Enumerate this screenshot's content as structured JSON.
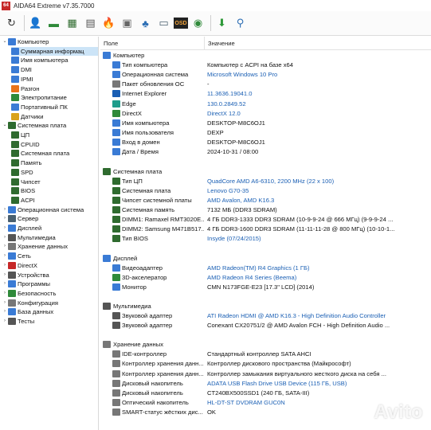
{
  "title": {
    "app_icon_text": "64",
    "text": "AIDA64 Extreme v7.35.7000"
  },
  "toolbar": {
    "buttons": [
      {
        "icon": "refresh-icon",
        "glyph": "↻",
        "color": "#333333"
      },
      {
        "icon": "user-icon",
        "glyph": "👤",
        "color": "#2e6fb5"
      },
      {
        "icon": "memory-icon",
        "glyph": "▬",
        "color": "#2f8a3a"
      },
      {
        "icon": "motherboard-icon",
        "glyph": "▦",
        "color": "#2f6b2f"
      },
      {
        "icon": "report-icon",
        "glyph": "▤",
        "color": "#555555"
      },
      {
        "icon": "flame-icon",
        "glyph": "🔥",
        "color": "#e8731a"
      },
      {
        "icon": "chip-icon",
        "glyph": "▣",
        "color": "#666666"
      },
      {
        "icon": "network-icon",
        "glyph": "♣",
        "color": "#2e6fb5"
      },
      {
        "icon": "disk-icon",
        "glyph": "▭",
        "color": "#4a6070"
      },
      {
        "icon": "osd-icon",
        "glyph": "OSD",
        "color": "#e8731a"
      },
      {
        "icon": "gauge-icon",
        "glyph": "◉",
        "color": "#2f8a3a"
      },
      {
        "icon": "download-icon",
        "glyph": "⬇",
        "color": "#2f9a3a"
      },
      {
        "icon": "search-icon",
        "glyph": "⚲",
        "color": "#2e6fb5"
      }
    ]
  },
  "tree": [
    {
      "label": "Компьютер",
      "level": 0,
      "exp": "⌄",
      "icon_color": "#3a7bd5",
      "selected": false
    },
    {
      "label": "Суммарная информац",
      "level": 1,
      "exp": "",
      "icon_color": "#3a7bd5",
      "selected": true
    },
    {
      "label": "Имя компьютера",
      "level": 1,
      "exp": "",
      "icon_color": "#3a7bd5",
      "selected": false
    },
    {
      "label": "DMI",
      "level": 1,
      "exp": "",
      "icon_color": "#3a7bd5",
      "selected": false
    },
    {
      "label": "IPMI",
      "level": 1,
      "exp": "",
      "icon_color": "#3a7bd5",
      "selected": false
    },
    {
      "label": "Разгон",
      "level": 1,
      "exp": "",
      "icon_color": "#e8731a",
      "selected": false
    },
    {
      "label": "Электропитание",
      "level": 1,
      "exp": "",
      "icon_color": "#2f8a3a",
      "selected": false
    },
    {
      "label": "Портативный ПК",
      "level": 1,
      "exp": "",
      "icon_color": "#3a7bd5",
      "selected": false
    },
    {
      "label": "Датчики",
      "level": 1,
      "exp": "",
      "icon_color": "#d9a21b",
      "selected": false
    },
    {
      "label": "Системная плата",
      "level": 0,
      "exp": "⌄",
      "icon_color": "#2f6b2f",
      "selected": false
    },
    {
      "label": "ЦП",
      "level": 1,
      "exp": "",
      "icon_color": "#2f6b2f",
      "selected": false
    },
    {
      "label": "CPUID",
      "level": 1,
      "exp": "",
      "icon_color": "#2f6b2f",
      "selected": false
    },
    {
      "label": "Системная плата",
      "level": 1,
      "exp": "",
      "icon_color": "#2f6b2f",
      "selected": false
    },
    {
      "label": "Память",
      "level": 1,
      "exp": "",
      "icon_color": "#2f6b2f",
      "selected": false
    },
    {
      "label": "SPD",
      "level": 1,
      "exp": "",
      "icon_color": "#2f6b2f",
      "selected": false
    },
    {
      "label": "Чипсет",
      "level": 1,
      "exp": "",
      "icon_color": "#2f6b2f",
      "selected": false
    },
    {
      "label": "BIOS",
      "level": 1,
      "exp": "",
      "icon_color": "#2f6b2f",
      "selected": false
    },
    {
      "label": "ACPI",
      "level": 1,
      "exp": "",
      "icon_color": "#2f6b2f",
      "selected": false
    },
    {
      "label": "Операционная система",
      "level": 0,
      "exp": "›",
      "icon_color": "#3a7bd5",
      "selected": false
    },
    {
      "label": "Сервер",
      "level": 0,
      "exp": "›",
      "icon_color": "#4a6070",
      "selected": false
    },
    {
      "label": "Дисплей",
      "level": 0,
      "exp": "›",
      "icon_color": "#3a7bd5",
      "selected": false
    },
    {
      "label": "Мультимедиа",
      "level": 0,
      "exp": "›",
      "icon_color": "#555555",
      "selected": false
    },
    {
      "label": "Хранение данных",
      "level": 0,
      "exp": "›",
      "icon_color": "#777777",
      "selected": false
    },
    {
      "label": "Сеть",
      "level": 0,
      "exp": "›",
      "icon_color": "#3a7bd5",
      "selected": false
    },
    {
      "label": "DirectX",
      "level": 0,
      "exp": "›",
      "icon_color": "#c62828",
      "selected": false
    },
    {
      "label": "Устройства",
      "level": 0,
      "exp": "›",
      "icon_color": "#555555",
      "selected": false
    },
    {
      "label": "Программы",
      "level": 0,
      "exp": "›",
      "icon_color": "#3a7bd5",
      "selected": false
    },
    {
      "label": "Безопасность",
      "level": 0,
      "exp": "›",
      "icon_color": "#2f8a3a",
      "selected": false
    },
    {
      "label": "Конфигурация",
      "level": 0,
      "exp": "›",
      "icon_color": "#777777",
      "selected": false
    },
    {
      "label": "База данных",
      "level": 0,
      "exp": "›",
      "icon_color": "#3a7bd5",
      "selected": false
    },
    {
      "label": "Тесты",
      "level": 0,
      "exp": "›",
      "icon_color": "#555555",
      "selected": false
    }
  ],
  "list": {
    "col_field": "Поле",
    "col_value": "Значение",
    "sections": [
      {
        "title": "Компьютер",
        "icon_color": "#3a7bd5",
        "rows": [
          {
            "name": "Тип компьютера",
            "value": "Компьютер с ACPI на базе x64",
            "link": false,
            "icon_color": "#3a7bd5"
          },
          {
            "name": "Операционная система",
            "value": "Microsoft Windows 10 Pro",
            "link": true,
            "icon_color": "#3a7bd5"
          },
          {
            "name": "Пакет обновления ОС",
            "value": "-",
            "link": false,
            "icon_color": "#777777"
          },
          {
            "name": "Internet Explorer",
            "value": "11.3636.19041.0",
            "link": true,
            "icon_color": "#1a5fb4"
          },
          {
            "name": "Edge",
            "value": "130.0.2849.52",
            "link": true,
            "icon_color": "#1e9d8b"
          },
          {
            "name": "DirectX",
            "value": "DirectX 12.0",
            "link": true,
            "icon_color": "#2f8a3a"
          },
          {
            "name": "Имя компьютера",
            "value": "DESKTOP-M8C6OJ1",
            "link": false,
            "icon_color": "#3a7bd5"
          },
          {
            "name": "Имя пользователя",
            "value": "DEXP",
            "link": false,
            "icon_color": "#3a7bd5"
          },
          {
            "name": "Вход в домен",
            "value": "DESKTOP-M8C6OJ1",
            "link": false,
            "icon_color": "#3a7bd5"
          },
          {
            "name": "Дата / Время",
            "value": "2024-10-31 / 08:00",
            "link": false,
            "icon_color": "#3a7bd5"
          }
        ]
      },
      {
        "title": "Системная плата",
        "icon_color": "#2f6b2f",
        "rows": [
          {
            "name": "Тип ЦП",
            "value": "QuadCore AMD A6-6310, 2200 MHz (22 x 100)",
            "link": true,
            "icon_color": "#2f6b2f"
          },
          {
            "name": "Системная плата",
            "value": "Lenovo G70-35",
            "link": true,
            "icon_color": "#2f6b2f"
          },
          {
            "name": "Чипсет системной платы",
            "value": "AMD Avalon, AMD K16.3",
            "link": true,
            "icon_color": "#2f6b2f"
          },
          {
            "name": "Системная память",
            "value": "7132 МБ  (DDR3 SDRAM)",
            "link": false,
            "icon_color": "#2f6b2f"
          },
          {
            "name": "DIMM1: Ramaxel RMT3020E...",
            "value": "4 ГБ DDR3-1333 DDR3 SDRAM  (10-9-9-24 @ 666 МГц)  (9-9-9-24 ...",
            "link": false,
            "icon_color": "#2f6b2f"
          },
          {
            "name": "DIMM2: Samsung M471B517...",
            "value": "4 ГБ DDR3-1600 DDR3 SDRAM  (11-11-11-28 @ 800 МГц)  (10-10-1...",
            "link": false,
            "icon_color": "#2f6b2f"
          },
          {
            "name": "Тип BIOS",
            "value": "Insyde (07/24/2015)",
            "link": true,
            "icon_color": "#2f6b2f"
          }
        ]
      },
      {
        "title": "Дисплей",
        "icon_color": "#3a7bd5",
        "rows": [
          {
            "name": "Видеоадаптер",
            "value": "AMD Radeon(TM) R4 Graphics  (1 ГБ)",
            "link": true,
            "icon_color": "#3a7bd5"
          },
          {
            "name": "3D-акселератор",
            "value": "AMD Radeon R4 Series (Beema)",
            "link": true,
            "icon_color": "#2f8a3a"
          },
          {
            "name": "Монитор",
            "value": "CMN N173FGE-E23  [17.3\" LCD]  (2014)",
            "link": false,
            "icon_color": "#3a7bd5"
          }
        ]
      },
      {
        "title": "Мультимедиа",
        "icon_color": "#555555",
        "rows": [
          {
            "name": "Звуковой адаптер",
            "value": "ATI Radeon HDMI @ AMD K16.3 - High Definition Audio Controller",
            "link": true,
            "icon_color": "#555555"
          },
          {
            "name": "Звуковой адаптер",
            "value": "Conexant CX20751/2 @ AMD Avalon FCH - High Definition Audio ...",
            "link": false,
            "icon_color": "#555555"
          }
        ]
      },
      {
        "title": "Хранение данных",
        "icon_color": "#777777",
        "rows": [
          {
            "name": "IDE-контроллер",
            "value": "Стандартный контроллер SATA AHCI",
            "link": false,
            "icon_color": "#777777"
          },
          {
            "name": "Контроллер хранения данн...",
            "value": "Контроллер дискового пространства (Майкрософт)",
            "link": false,
            "icon_color": "#777777"
          },
          {
            "name": "Контроллер хранения данн...",
            "value": "Контроллер замыкания виртуального жесткого диска на себя ...",
            "link": false,
            "icon_color": "#777777"
          },
          {
            "name": "Дисковый накопитель",
            "value": "ADATA USB Flash Drive USB Device  (115 ГБ, USB)",
            "link": true,
            "icon_color": "#777777"
          },
          {
            "name": "Дисковый накопитель",
            "value": "CT240BX500SSD1  (240 ГБ, SATA-III)",
            "link": false,
            "icon_color": "#777777"
          },
          {
            "name": "Оптический накопитель",
            "value": "HL-DT-ST DVDRAM GUC0N",
            "link": true,
            "icon_color": "#777777"
          },
          {
            "name": "SMART-статус жёстких дис...",
            "value": "OK",
            "link": false,
            "icon_color": "#777777"
          }
        ]
      }
    ]
  },
  "watermark": "Avito"
}
